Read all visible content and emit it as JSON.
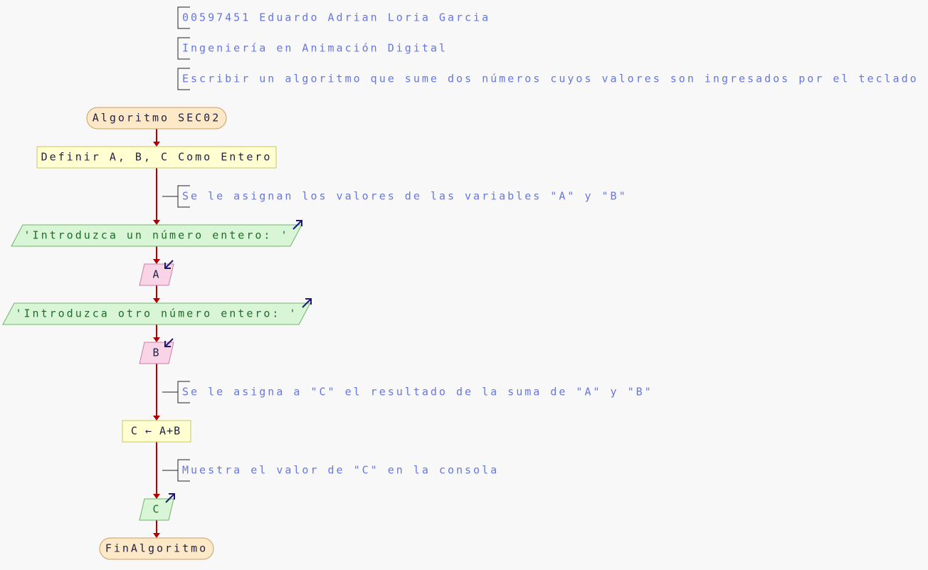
{
  "header": {
    "student": "00597451 Eduardo Adrian Loria Garcia",
    "program": "Ingeniería en Animación Digital",
    "task": "Escribir un algoritmo que sume dos números cuyos valores son ingresados por el teclado"
  },
  "flow": {
    "start": "Algoritmo SEC02",
    "define": "Definir A, B, C Como Entero",
    "comment_assign_values": "Se le asignan los valores de las variables \"A\" y \"B\"",
    "write_prompt_1": "'Introduzca un número entero: '",
    "read_a": "A",
    "write_prompt_2": "'Introduzca otro número entero: '",
    "read_b": "B",
    "comment_sum": "Se le asigna a \"C\" el resultado de la suma de \"A\" y \"B\"",
    "assign": "C ← A+B",
    "comment_show": "Muestra el valor de \"C\" en la consola",
    "write_c": "C",
    "end": "FinAlgoritmo"
  },
  "colors": {
    "comment_text": "#6677dd",
    "terminal_fill": "#fde9c8",
    "terminal_stroke": "#c8a060",
    "process_fill": "#ffffd2",
    "process_stroke": "#c8c860",
    "output_fill": "#d8f5d6",
    "output_stroke": "#6fb36a",
    "input_fill": "#f9d3e6",
    "input_stroke": "#c97fa6",
    "flow_line": "#b00000",
    "io_arrow": "#1a1a7a"
  }
}
